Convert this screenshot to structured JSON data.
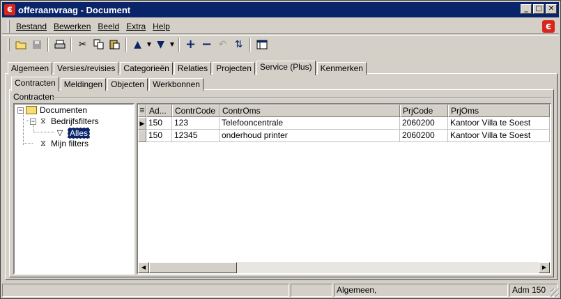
{
  "window": {
    "title": "offeraanvraag - Document",
    "controls": [
      "_",
      "□",
      "✕"
    ]
  },
  "menu": [
    "Bestand",
    "Bewerken",
    "Beeld",
    "Extra",
    "Help"
  ],
  "tabs": {
    "main": [
      "Algemeen",
      "Versies/revisies",
      "Categorieën",
      "Relaties",
      "Projecten",
      "Service (Plus)",
      "Kenmerken"
    ],
    "main_active": "Service (Plus)",
    "sub": [
      "Contracten",
      "Meldingen",
      "Objecten",
      "Werkbonnen"
    ],
    "sub_active": "Contracten"
  },
  "group_label": "Contracten",
  "tree": {
    "root": "Documenten",
    "company_filters": "Bedrijfsfilters",
    "all": "Alles",
    "my_filters": "Mijn filters"
  },
  "grid": {
    "columns": [
      "Ad...",
      "ContrCode",
      "ContrOms",
      "PrjCode",
      "PrjOms"
    ],
    "rows": [
      [
        "150",
        "123",
        "Telefooncentrale",
        "2060200",
        "Kantoor Villa te Soest"
      ],
      [
        "150",
        "12345",
        "onderhoud printer",
        "2060200",
        "Kantoor Villa te Soest"
      ]
    ]
  },
  "status": {
    "p1": "",
    "p2": "",
    "p3": "Algemeen,",
    "p4": "Adm 150"
  },
  "colors": {
    "titlebar": "#0a246a",
    "brand": "#d9261c",
    "face": "#d4d0c8"
  }
}
